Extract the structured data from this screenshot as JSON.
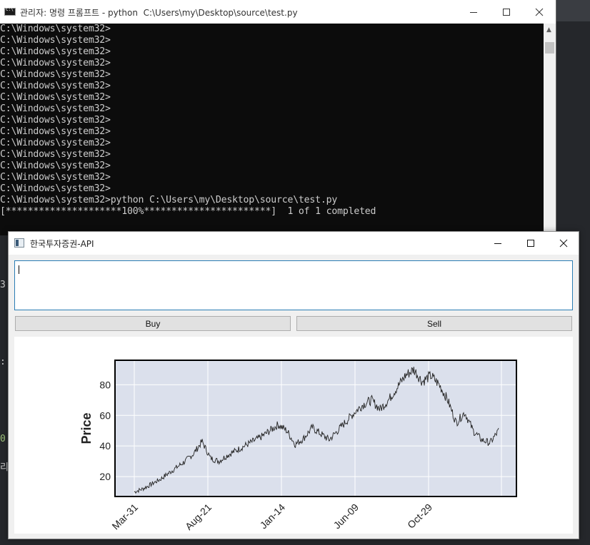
{
  "cmd": {
    "title": "관리자: 명령 프롬프트 - python  C:\\Users\\my\\Desktop\\source\\test.py",
    "lines": [
      "C:\\Windows\\system32>",
      "C:\\Windows\\system32>",
      "C:\\Windows\\system32>",
      "C:\\Windows\\system32>",
      "C:\\Windows\\system32>",
      "C:\\Windows\\system32>",
      "C:\\Windows\\system32>",
      "C:\\Windows\\system32>",
      "C:\\Windows\\system32>",
      "C:\\Windows\\system32>",
      "C:\\Windows\\system32>",
      "C:\\Windows\\system32>",
      "C:\\Windows\\system32>",
      "C:\\Windows\\system32>",
      "C:\\Windows\\system32>",
      "C:\\Windows\\system32>python C:\\Users\\my\\Desktop\\source\\test.py",
      "[*********************100%***********************]  1 of 1 completed"
    ]
  },
  "app": {
    "title": "한국투자증권-API",
    "input_value": "",
    "buy_label": "Buy",
    "sell_label": "Sell"
  },
  "background": {
    "glyphs": [
      "3",
      ":",
      "0",
      "리"
    ]
  },
  "chart_data": {
    "type": "line",
    "xlabel": "",
    "ylabel": "Price",
    "ylim": [
      7,
      96
    ],
    "yticks": [
      20,
      40,
      60,
      80
    ],
    "x_tick_labels": [
      "Mar-31",
      "Aug-21",
      "Jan-14",
      "Jun-09",
      "Oct-29"
    ],
    "grid": true,
    "background_color": "#dbe0ec",
    "line_color": "#222222",
    "series": [
      {
        "values": [
          10,
          12,
          15,
          18,
          22,
          26,
          30,
          35,
          43,
          32,
          30,
          34,
          37,
          40,
          43,
          46,
          50,
          54,
          50,
          41,
          45,
          52,
          48,
          44,
          50,
          56,
          62,
          67,
          70,
          64,
          70,
          78,
          86,
          90,
          82,
          86,
          80,
          70,
          55,
          62,
          50,
          44,
          42,
          50
        ]
      }
    ]
  }
}
